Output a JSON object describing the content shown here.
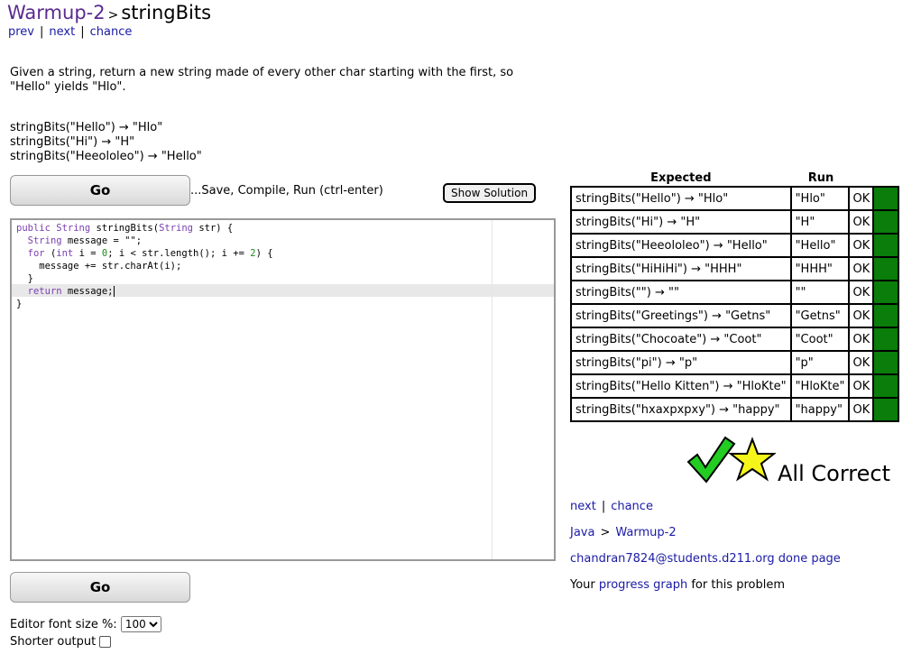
{
  "header": {
    "category": "Warmup-2",
    "separator": ">",
    "problem": "stringBits"
  },
  "nav_top": {
    "prev": "prev",
    "next": "next",
    "chance": "chance",
    "divider": "|"
  },
  "description": {
    "line1": "Given a string, return a new string made of every other char starting with the first, so",
    "line2": "\"Hello\" yields \"Hlo\"."
  },
  "examples": [
    "stringBits(\"Hello\") → \"Hlo\"",
    "stringBits(\"Hi\") → \"H\"",
    "stringBits(\"Heeololeo\") → \"Hello\""
  ],
  "go_button_label": "Go",
  "go_hint": "...Save, Compile, Run (ctrl-enter)",
  "show_solution_label": "Show Solution",
  "code_lines": [
    "public String stringBits(String str) {",
    "  String message = \"\";",
    "  for (int i = 0; i < str.length(); i += 2) {",
    "    message += str.charAt(i);",
    "  }",
    "  return message;",
    "}"
  ],
  "editor_font_label": "Editor font size %:",
  "editor_font_value": "100",
  "shorter_output_label": "Shorter output",
  "results": {
    "headers": {
      "expected": "Expected",
      "run": "Run"
    },
    "rows": [
      {
        "expected": "stringBits(\"Hello\") → \"Hlo\"",
        "run": "\"Hlo\"",
        "status": "OK"
      },
      {
        "expected": "stringBits(\"Hi\") → \"H\"",
        "run": "\"H\"",
        "status": "OK"
      },
      {
        "expected": "stringBits(\"Heeololeo\") → \"Hello\"",
        "run": "\"Hello\"",
        "status": "OK"
      },
      {
        "expected": "stringBits(\"HiHiHi\") → \"HHH\"",
        "run": "\"HHH\"",
        "status": "OK"
      },
      {
        "expected": "stringBits(\"\") → \"\"",
        "run": "\"\"",
        "status": "OK"
      },
      {
        "expected": "stringBits(\"Greetings\") → \"Getns\"",
        "run": "\"Getns\"",
        "status": "OK"
      },
      {
        "expected": "stringBits(\"Chocoate\") → \"Coot\"",
        "run": "\"Coot\"",
        "status": "OK"
      },
      {
        "expected": "stringBits(\"pi\") → \"p\"",
        "run": "\"p\"",
        "status": "OK"
      },
      {
        "expected": "stringBits(\"Hello Kitten\") → \"HloKte\"",
        "run": "\"HloKte\"",
        "status": "OK"
      },
      {
        "expected": "stringBits(\"hxaxpxpxy\") → \"happy\"",
        "run": "\"happy\"",
        "status": "OK"
      }
    ],
    "pass_color": "#0a7d0a"
  },
  "all_correct": {
    "text": "All Correct",
    "check_icon": "checkmark-icon",
    "star_icon": "star-icon"
  },
  "nav_bottom": {
    "next": "next",
    "chance": "chance",
    "divider": "|"
  },
  "breadcrumb": {
    "java": "Java",
    "sep": ">",
    "section": "Warmup-2"
  },
  "user": {
    "email": "chandran7824@students.d211.org",
    "done_page": "done page"
  },
  "progress": {
    "prefix": "Your",
    "link": "progress graph",
    "suffix": "for this problem"
  }
}
